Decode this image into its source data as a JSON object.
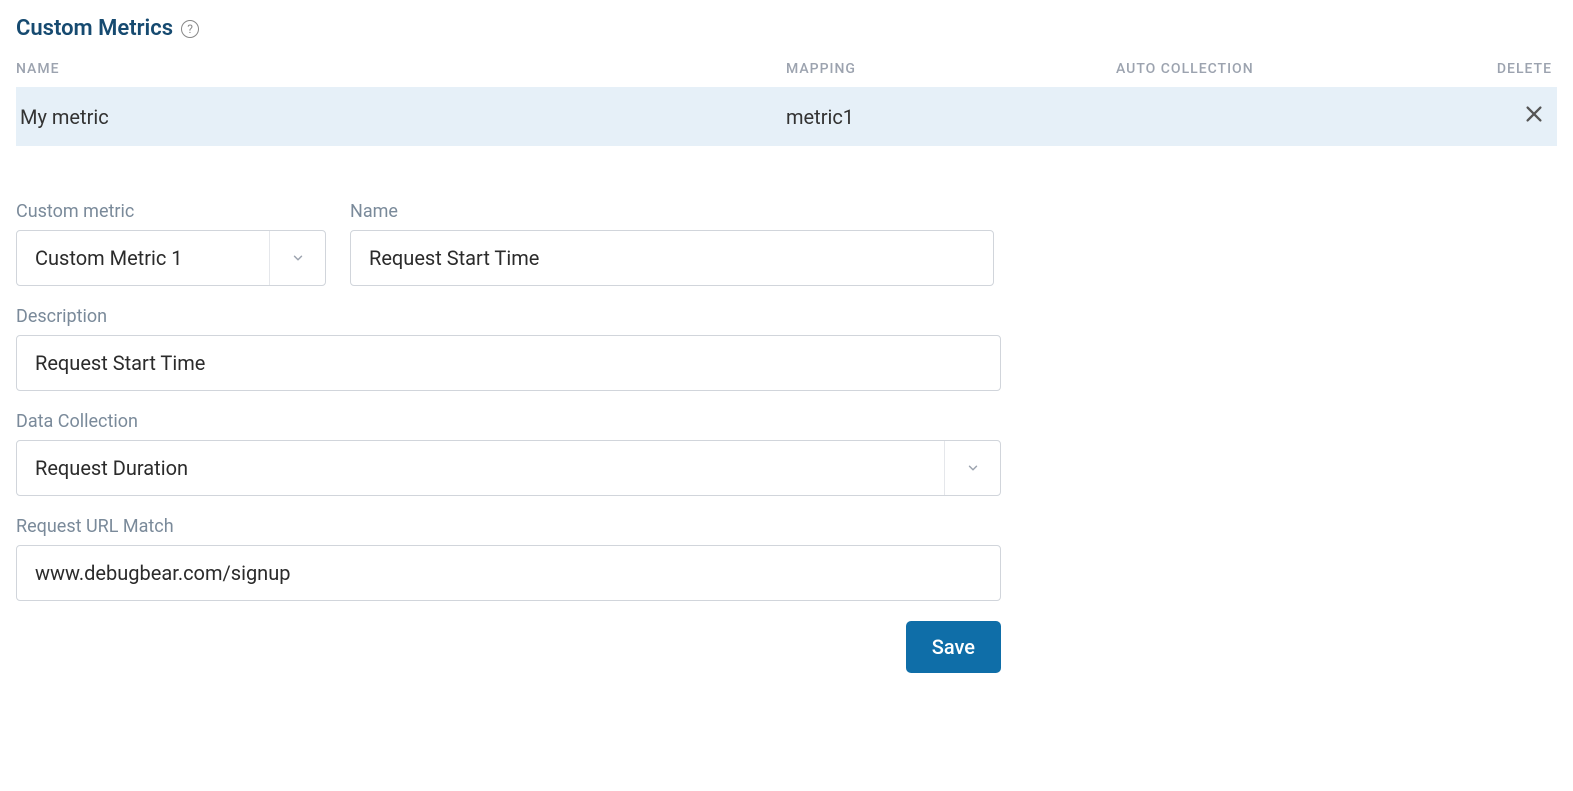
{
  "header": {
    "title": "Custom Metrics"
  },
  "table": {
    "columns": {
      "name": "NAME",
      "mapping": "MAPPING",
      "auto_collection": "AUTO COLLECTION",
      "delete": "DELETE"
    },
    "rows": [
      {
        "name": "My metric",
        "mapping": "metric1",
        "auto_collection": ""
      }
    ]
  },
  "form": {
    "custom_metric": {
      "label": "Custom metric",
      "value": "Custom Metric 1"
    },
    "name": {
      "label": "Name",
      "value": "Request Start Time"
    },
    "description": {
      "label": "Description",
      "value": "Request Start Time"
    },
    "data_collection": {
      "label": "Data Collection",
      "value": "Request Duration"
    },
    "request_url_match": {
      "label": "Request URL Match",
      "value": "www.debugbear.com/signup"
    },
    "save_label": "Save"
  }
}
